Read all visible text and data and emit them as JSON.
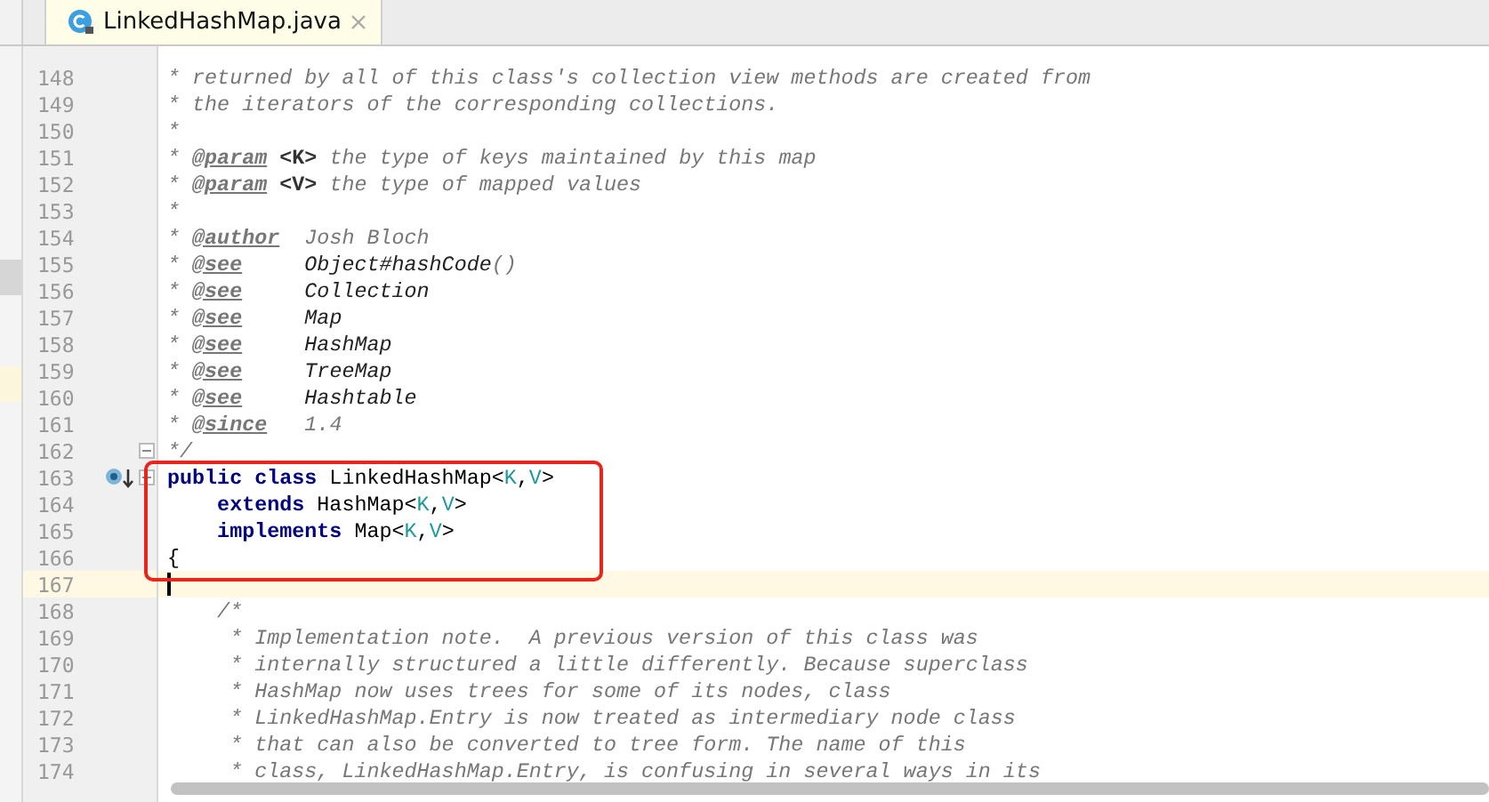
{
  "tab": {
    "title": "LinkedHashMap.java",
    "selected": true
  },
  "lines": [
    {
      "number": "148",
      "current": false,
      "boxed": false,
      "tokens": [
        {
          "kind": "comment",
          "text": "* returned by all of this class's collection view methods are created from"
        }
      ]
    },
    {
      "number": "149",
      "current": false,
      "boxed": false,
      "tokens": [
        {
          "kind": "comment",
          "text": "* the iterators of the corresponding collections."
        }
      ]
    },
    {
      "number": "150",
      "current": false,
      "boxed": false,
      "tokens": [
        {
          "kind": "comment",
          "text": "*"
        }
      ]
    },
    {
      "number": "151",
      "current": false,
      "boxed": false,
      "tokens": [
        {
          "kind": "comment",
          "text": "* "
        },
        {
          "kind": "doctag",
          "text": "@param"
        },
        {
          "kind": "docparam",
          "text": " <K>"
        },
        {
          "kind": "comment",
          "text": " the type of keys maintained by this map"
        }
      ]
    },
    {
      "number": "152",
      "current": false,
      "boxed": false,
      "tokens": [
        {
          "kind": "comment",
          "text": "* "
        },
        {
          "kind": "doctag",
          "text": "@param"
        },
        {
          "kind": "docparam",
          "text": " <V>"
        },
        {
          "kind": "comment",
          "text": " the type of mapped values"
        }
      ]
    },
    {
      "number": "153",
      "current": false,
      "boxed": false,
      "tokens": [
        {
          "kind": "comment",
          "text": "*"
        }
      ]
    },
    {
      "number": "154",
      "current": false,
      "boxed": false,
      "tokens": [
        {
          "kind": "comment",
          "text": "* "
        },
        {
          "kind": "doctag",
          "text": "@author"
        },
        {
          "kind": "comment",
          "text": "  Josh Bloch"
        }
      ]
    },
    {
      "number": "155",
      "current": false,
      "boxed": false,
      "tokens": [
        {
          "kind": "comment",
          "text": "* "
        },
        {
          "kind": "doctag",
          "text": "@see"
        },
        {
          "kind": "docref",
          "text": "     Object#hashCode"
        },
        {
          "kind": "comment",
          "text": "()"
        }
      ]
    },
    {
      "number": "156",
      "current": false,
      "boxed": false,
      "tokens": [
        {
          "kind": "comment",
          "text": "* "
        },
        {
          "kind": "doctag",
          "text": "@see"
        },
        {
          "kind": "docref",
          "text": "     Collection"
        }
      ]
    },
    {
      "number": "157",
      "current": false,
      "boxed": false,
      "tokens": [
        {
          "kind": "comment",
          "text": "* "
        },
        {
          "kind": "doctag",
          "text": "@see"
        },
        {
          "kind": "docref",
          "text": "     Map"
        }
      ]
    },
    {
      "number": "158",
      "current": false,
      "boxed": false,
      "tokens": [
        {
          "kind": "comment",
          "text": "* "
        },
        {
          "kind": "doctag",
          "text": "@see"
        },
        {
          "kind": "docref",
          "text": "     HashMap"
        }
      ]
    },
    {
      "number": "159",
      "current": false,
      "boxed": false,
      "tokens": [
        {
          "kind": "comment",
          "text": "* "
        },
        {
          "kind": "doctag",
          "text": "@see"
        },
        {
          "kind": "docref",
          "text": "     TreeMap"
        }
      ]
    },
    {
      "number": "160",
      "current": false,
      "boxed": false,
      "tokens": [
        {
          "kind": "comment",
          "text": "* "
        },
        {
          "kind": "doctag",
          "text": "@see"
        },
        {
          "kind": "docref",
          "text": "     Hashtable"
        }
      ]
    },
    {
      "number": "161",
      "current": false,
      "boxed": false,
      "tokens": [
        {
          "kind": "comment",
          "text": "* "
        },
        {
          "kind": "doctag",
          "text": "@since"
        },
        {
          "kind": "comment",
          "text": "   1.4"
        }
      ]
    },
    {
      "number": "162",
      "current": false,
      "boxed": false,
      "fold": true,
      "tokens": [
        {
          "kind": "comment",
          "text": "*/"
        }
      ]
    },
    {
      "number": "163",
      "current": false,
      "boxed": true,
      "marker": true,
      "fold": true,
      "tokens": [
        {
          "kind": "keyword",
          "text": "public class"
        },
        {
          "kind": "plain",
          "text": " LinkedHashMap<"
        },
        {
          "kind": "typeparam",
          "text": "K"
        },
        {
          "kind": "plain",
          "text": ","
        },
        {
          "kind": "typeparam",
          "text": "V"
        },
        {
          "kind": "plain",
          "text": ">"
        }
      ]
    },
    {
      "number": "164",
      "current": false,
      "boxed": true,
      "tokens": [
        {
          "kind": "keyword",
          "text": "    extends"
        },
        {
          "kind": "plain",
          "text": " HashMap<"
        },
        {
          "kind": "typeparam",
          "text": "K"
        },
        {
          "kind": "plain",
          "text": ","
        },
        {
          "kind": "typeparam",
          "text": "V"
        },
        {
          "kind": "plain",
          "text": ">"
        }
      ]
    },
    {
      "number": "165",
      "current": false,
      "boxed": true,
      "tokens": [
        {
          "kind": "keyword",
          "text": "    implements"
        },
        {
          "kind": "plain",
          "text": " Map<"
        },
        {
          "kind": "typeparam",
          "text": "K"
        },
        {
          "kind": "plain",
          "text": ","
        },
        {
          "kind": "typeparam",
          "text": "V"
        },
        {
          "kind": "plain",
          "text": ">"
        }
      ]
    },
    {
      "number": "166",
      "current": false,
      "boxed": true,
      "tokens": [
        {
          "kind": "plain",
          "text": "{"
        }
      ]
    },
    {
      "number": "167",
      "current": true,
      "boxed": false
    },
    {
      "number": "168",
      "current": false,
      "boxed": false,
      "tokens": [
        {
          "kind": "comment",
          "text": "    /*"
        }
      ]
    },
    {
      "number": "169",
      "current": false,
      "boxed": false,
      "tokens": [
        {
          "kind": "comment",
          "text": "     * Implementation note.  A previous version of this class was"
        }
      ]
    },
    {
      "number": "170",
      "current": false,
      "boxed": false,
      "tokens": [
        {
          "kind": "comment",
          "text": "     * internally structured a little differently. Because superclass"
        }
      ]
    },
    {
      "number": "171",
      "current": false,
      "boxed": false,
      "tokens": [
        {
          "kind": "comment",
          "text": "     * HashMap now uses trees for some of its nodes, class"
        }
      ]
    },
    {
      "number": "172",
      "current": false,
      "boxed": false,
      "tokens": [
        {
          "kind": "comment",
          "text": "     * LinkedHashMap.Entry is now treated as intermediary node class"
        }
      ]
    },
    {
      "number": "173",
      "current": false,
      "boxed": false,
      "tokens": [
        {
          "kind": "comment",
          "text": "     * that can also be converted to tree form. The name of this"
        }
      ]
    },
    {
      "number": "174",
      "current": false,
      "boxed": false,
      "tokens": [
        {
          "kind": "comment",
          "text": "     * class, LinkedHashMap.Entry, is confusing in several ways in its"
        }
      ]
    }
  ]
}
